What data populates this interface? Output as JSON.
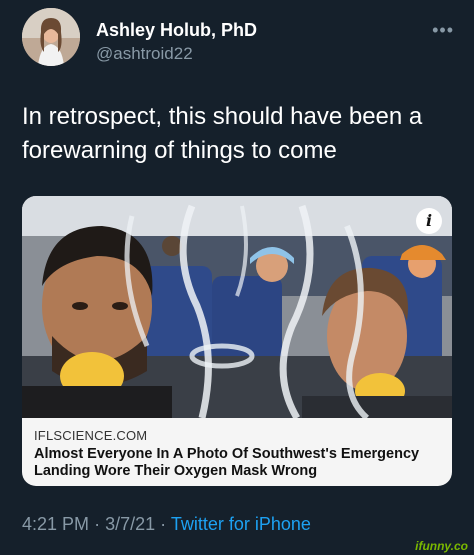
{
  "author": {
    "display_name": "Ashley Holub, PhD",
    "handle": "@ashtroid22",
    "avatar_icon": "profile-photo"
  },
  "more_icon": "more-horizontal-icon",
  "tweet": {
    "text": "In retrospect, this should have been a forewarning of things to come"
  },
  "link_card": {
    "source": "IFLSCIENCE.COM",
    "title": "Almost Everyone In A Photo Of Southwest's Emergency Landing Wore Their Oxygen Mask Wrong",
    "info_glyph": "i"
  },
  "meta": {
    "time": "4:21 PM",
    "separator": "·",
    "date": "3/7/21",
    "app": "Twitter for iPhone"
  },
  "watermark": "ifunny.co",
  "colors": {
    "background": "#15202b",
    "secondary_text": "#8899a6",
    "link": "#1da1f2"
  }
}
